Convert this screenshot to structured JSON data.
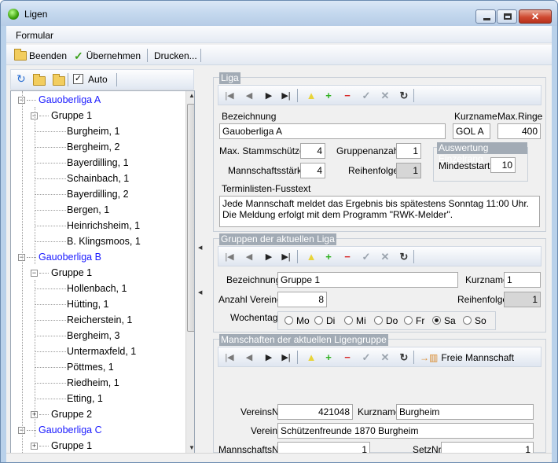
{
  "window": {
    "title": "Ligen"
  },
  "menu": {
    "formular": "Formular"
  },
  "toolbar": {
    "beenden": "Beenden",
    "uebernehmen": "Übernehmen",
    "drucken": "Drucken..."
  },
  "left": {
    "auto_label": "Auto"
  },
  "tree": [
    {
      "text": "Gauoberliga A",
      "level": 0,
      "blue": true,
      "expander": "-"
    },
    {
      "text": "Gruppe 1",
      "level": 1,
      "blue": false,
      "expander": "-"
    },
    {
      "text": "Burgheim, 1",
      "level": 2
    },
    {
      "text": "Bergheim, 2",
      "level": 2
    },
    {
      "text": "Bayerdilling, 1",
      "level": 2
    },
    {
      "text": "Schainbach, 1",
      "level": 2
    },
    {
      "text": "Bayerdilling, 2",
      "level": 2
    },
    {
      "text": "Bergen, 1",
      "level": 2
    },
    {
      "text": "Heinrichsheim, 1",
      "level": 2
    },
    {
      "text": "B. Klingsmoos, 1",
      "level": 2
    },
    {
      "text": "Gauoberliga B",
      "level": 0,
      "blue": true,
      "expander": "-"
    },
    {
      "text": "Gruppe 1",
      "level": 1,
      "blue": false,
      "expander": "-"
    },
    {
      "text": "Hollenbach, 1",
      "level": 2
    },
    {
      "text": "Hütting, 1",
      "level": 2
    },
    {
      "text": "Reicherstein, 1",
      "level": 2
    },
    {
      "text": "Bergheim, 3",
      "level": 2
    },
    {
      "text": "Untermaxfeld, 1",
      "level": 2
    },
    {
      "text": "Pöttmes, 1",
      "level": 2
    },
    {
      "text": "Riedheim, 1",
      "level": 2
    },
    {
      "text": "Etting, 1",
      "level": 2
    },
    {
      "text": "Gruppe 2",
      "level": 1,
      "blue": false,
      "expander": "+"
    },
    {
      "text": "Gauoberliga C",
      "level": 0,
      "blue": true,
      "expander": "-"
    },
    {
      "text": "Gruppe 1",
      "level": 1,
      "blue": false,
      "expander": "+"
    }
  ],
  "liga": {
    "title": "Liga",
    "bezeichnung_label": "Bezeichnung",
    "bezeichnung": "Gauoberliga A",
    "kurzname_label": "Kurzname",
    "kurzname": "GOL A",
    "maxringe_label": "Max.Ringe",
    "maxringe": "400",
    "stammschuetzen_label": "Max. Stammschützen",
    "stammschuetzen": "4",
    "gruppenanzahl_label": "Gruppenanzahl",
    "gruppenanzahl": "1",
    "mannschaftsstaerke_label": "Mannschaftsstärke",
    "mannschaftsstaerke": "4",
    "reihenfolge_label": "Reihenfolge",
    "reihenfolge": "1",
    "auswertung_title": "Auswertung Einzelrang",
    "mindeststarts_label": "Mindeststarts",
    "mindeststarts": "10",
    "fusstext_label": "Terminlisten-Fusstext",
    "fusstext_line1": "Jede Mannschaft meldet das Ergebnis bis spätestens Sonntag 11:00 Uhr.",
    "fusstext_line2": "Die Meldung erfolgt mit dem Programm \"RWK-Melder\"."
  },
  "gruppen": {
    "title": "Gruppen der aktuellen Liga",
    "bezeichnung_label": "Bezeichnung",
    "bezeichnung": "Gruppe 1",
    "kurzname_label": "Kurzname",
    "kurzname": "1",
    "anzahl_label": "Anzahl Vereine",
    "anzahl": "8",
    "reihenfolge_label": "Reihenfolge",
    "reihenfolge": "1",
    "wochentag_label": "Wochentag",
    "days": [
      "Mo",
      "Di",
      "Mi",
      "Do",
      "Fr",
      "Sa",
      "So"
    ],
    "selected_day": "Sa"
  },
  "mannschaften": {
    "title": "Manschaften der aktuellen Ligengruppe",
    "freie_label": "Freie Mannschaft",
    "vereinsnr_label": "VereinsNr",
    "vereinsnr": "421048",
    "kurzname_label": "Kurzname",
    "kurzname": "Burgheim",
    "verein_label": "Verein",
    "verein": "Schützenfreunde 1870 Burgheim",
    "mannschaftsnr_label": "MannschaftsNr",
    "mannschaftsnr": "1",
    "setznr_label": "SetzNr",
    "setznr": "1"
  },
  "colors": {
    "accent_blue": "#1a1aff",
    "group_title_bg": "#a2abb5",
    "window_frame": "#b9d1ea"
  }
}
